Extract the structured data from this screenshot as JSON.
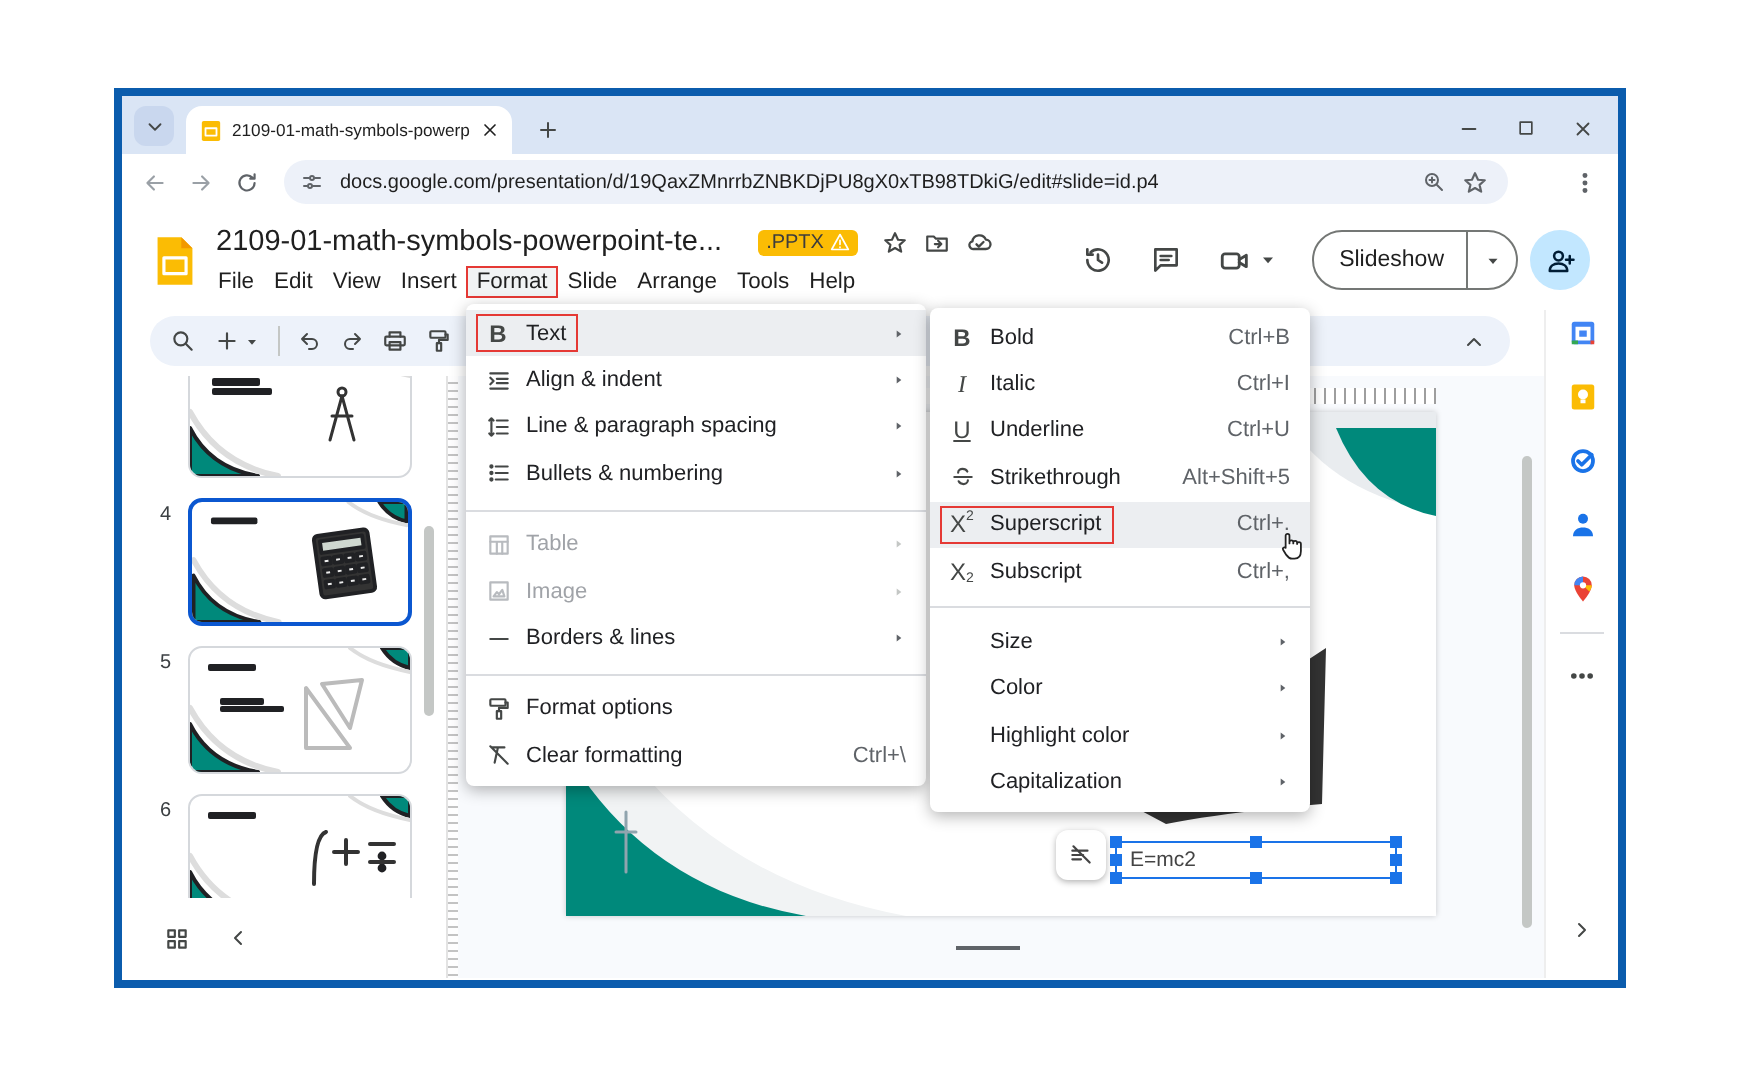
{
  "browser": {
    "tab_title": "2109-01-math-symbols-powerp",
    "url": "docs.google.com/presentation/d/19QaxZMnrrbZNBKDjPU8gX0xTB98TDkiG/edit#slide=id.p4"
  },
  "document": {
    "title": "2109-01-math-symbols-powerpoint-te...",
    "badge": ".PPTX"
  },
  "menubar": [
    {
      "label": "File",
      "selected": false
    },
    {
      "label": "Edit",
      "selected": false
    },
    {
      "label": "View",
      "selected": false
    },
    {
      "label": "Insert",
      "selected": false
    },
    {
      "label": "Format",
      "selected": true
    },
    {
      "label": "Slide",
      "selected": false
    },
    {
      "label": "Arrange",
      "selected": false
    },
    {
      "label": "Tools",
      "selected": false
    },
    {
      "label": "Help",
      "selected": false
    }
  ],
  "slideshow_button": "Slideshow",
  "slides": [
    {
      "selected": false
    },
    {
      "number": "4",
      "selected": true
    },
    {
      "number": "5",
      "selected": false
    },
    {
      "number": "6",
      "selected": false
    }
  ],
  "format_menu": {
    "groups": [
      [
        {
          "label": "Text",
          "glyph": "B",
          "submenu": true,
          "selected": true,
          "disabled": false
        },
        {
          "label": "Align & indent",
          "submenu": true,
          "selected": false,
          "disabled": false
        },
        {
          "label": "Line & paragraph spacing",
          "submenu": true,
          "selected": false,
          "disabled": false
        },
        {
          "label": "Bullets & numbering",
          "submenu": true,
          "selected": false,
          "disabled": false
        }
      ],
      [
        {
          "label": "Table",
          "submenu": true,
          "selected": false,
          "disabled": true
        },
        {
          "label": "Image",
          "submenu": true,
          "selected": false,
          "disabled": true
        },
        {
          "label": "Borders & lines",
          "submenu": true,
          "selected": false,
          "disabled": false
        }
      ],
      [
        {
          "label": "Format options",
          "submenu": false,
          "selected": false,
          "disabled": false
        },
        {
          "label": "Clear formatting",
          "shortcut": "Ctrl+\\",
          "submenu": false,
          "selected": false,
          "disabled": false
        }
      ]
    ]
  },
  "text_submenu": {
    "groups": [
      [
        {
          "label": "Bold",
          "glyph": "B",
          "shortcut": "Ctrl+B",
          "submenu": false,
          "selected": false,
          "disabled": false
        },
        {
          "label": "Italic",
          "glyph": "I",
          "shortcut": "Ctrl+I",
          "submenu": false,
          "selected": false,
          "disabled": false
        },
        {
          "label": "Underline",
          "glyph": "U",
          "shortcut": "Ctrl+U",
          "submenu": false,
          "selected": false,
          "disabled": false
        },
        {
          "label": "Strikethrough",
          "shortcut": "Alt+Shift+5",
          "submenu": false,
          "selected": false,
          "disabled": false
        },
        {
          "label": "Superscript",
          "glyph": "X$^{2}$",
          "shortcut": "Ctrl+.",
          "submenu": false,
          "selected": true,
          "disabled": false
        },
        {
          "label": "Subscript",
          "glyph": "X$_{2}$",
          "shortcut": "Ctrl+,",
          "submenu": false,
          "selected": false,
          "disabled": false
        }
      ],
      [
        {
          "label": "Size",
          "submenu": true,
          "selected": false,
          "disabled": false
        },
        {
          "label": "Color",
          "submenu": true,
          "selected": false,
          "disabled": false
        },
        {
          "label": "Highlight color",
          "submenu": true,
          "selected": false,
          "disabled": false
        },
        {
          "label": "Capitalization",
          "submenu": true,
          "selected": false,
          "disabled": false
        }
      ]
    ]
  },
  "canvas": {
    "text_box": "E=mc2"
  }
}
